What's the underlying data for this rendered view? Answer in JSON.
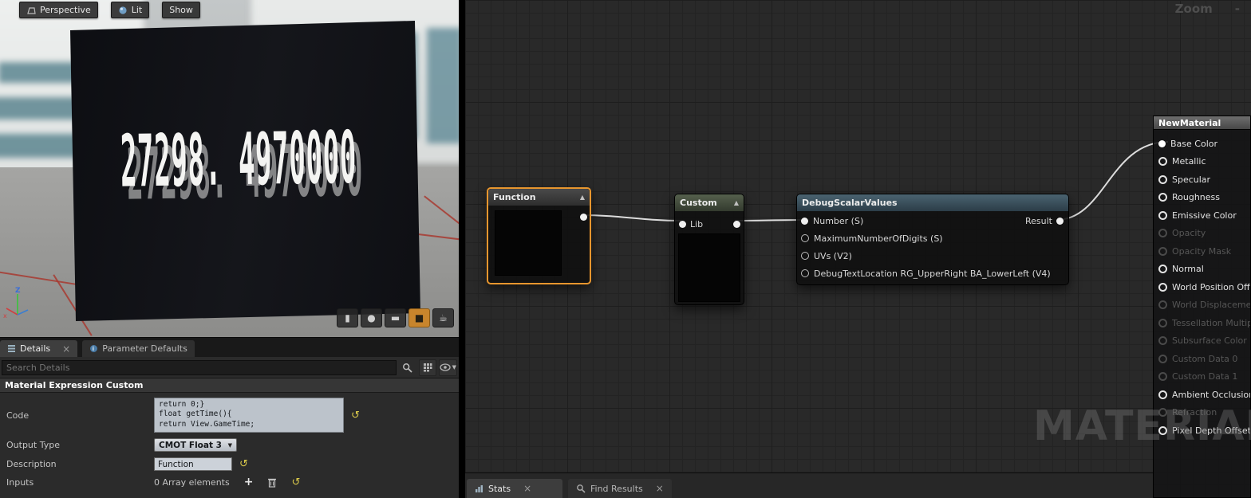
{
  "icons": {
    "close": "×",
    "collapse": "▲",
    "dropdown": "▼",
    "reset": "↺",
    "add": "+",
    "minus": "-"
  },
  "colors": {
    "selection_orange": "#e8962e",
    "wire": "#dcdcdc",
    "debug_header": "#46606d",
    "custom_header": "#4e5a49",
    "reset_yellow": "#d9c84a",
    "active_mesh_button": "#c8852c"
  },
  "viewport": {
    "toolbar": {
      "perspective": "Perspective",
      "lit": "Lit",
      "show": "Show"
    },
    "preview_text": "27298. 4970000",
    "preview_mesh": {
      "cylinder": "▮",
      "sphere": "●",
      "plane": "▬",
      "cube": "■",
      "teapot": "☕"
    }
  },
  "details": {
    "tabs": {
      "details": "Details",
      "parameter_defaults": "Parameter Defaults"
    },
    "search": {
      "placeholder": "Search Details"
    },
    "section_title": "Material Expression Custom",
    "fields": {
      "code": {
        "label": "Code",
        "value": "return 0;}\nfloat getTime(){\nreturn View.GameTime;"
      },
      "output_type": {
        "label": "Output Type",
        "value": "CMOT Float 3"
      },
      "description": {
        "label": "Description",
        "value": "Function"
      },
      "inputs": {
        "label": "Inputs",
        "value": "0 Array elements"
      }
    }
  },
  "graph": {
    "zoom_label": "Zoom",
    "zoom_trail": "-",
    "watermark": "MATERIAL",
    "nodes": {
      "function": {
        "title": "Function"
      },
      "custom": {
        "title": "Custom",
        "input_pin": "Lib"
      },
      "debug_scalar_values": {
        "title": "DebugScalarValues",
        "inputs": [
          "Number (S)",
          "MaximumNumberOfDigits (S)",
          "UVs (V2)",
          "DebugTextLocation RG_UpperRight BA_LowerLeft (V4)"
        ],
        "output": "Result"
      },
      "new_material": {
        "title": "NewMaterial",
        "pins": [
          {
            "label": "Base Color",
            "state": "connected"
          },
          {
            "label": "Metallic",
            "state": "enabled"
          },
          {
            "label": "Specular",
            "state": "enabled"
          },
          {
            "label": "Roughness",
            "state": "enabled"
          },
          {
            "label": "Emissive Color",
            "state": "enabled"
          },
          {
            "label": "Opacity",
            "state": "disabled"
          },
          {
            "label": "Opacity Mask",
            "state": "disabled"
          },
          {
            "label": "Normal",
            "state": "enabled"
          },
          {
            "label": "World Position Offset",
            "state": "enabled"
          },
          {
            "label": "World Displacement",
            "state": "disabled"
          },
          {
            "label": "Tessellation Multiplier",
            "state": "disabled"
          },
          {
            "label": "Subsurface Color",
            "state": "disabled"
          },
          {
            "label": "Custom Data 0",
            "state": "disabled"
          },
          {
            "label": "Custom Data 1",
            "state": "disabled"
          },
          {
            "label": "Ambient Occlusion",
            "state": "enabled"
          },
          {
            "label": "Refraction",
            "state": "disabled"
          },
          {
            "label": "Pixel Depth Offset",
            "state": "enabled"
          }
        ]
      }
    },
    "bottom_tabs": {
      "stats": "Stats",
      "find_results": "Find Results"
    }
  }
}
